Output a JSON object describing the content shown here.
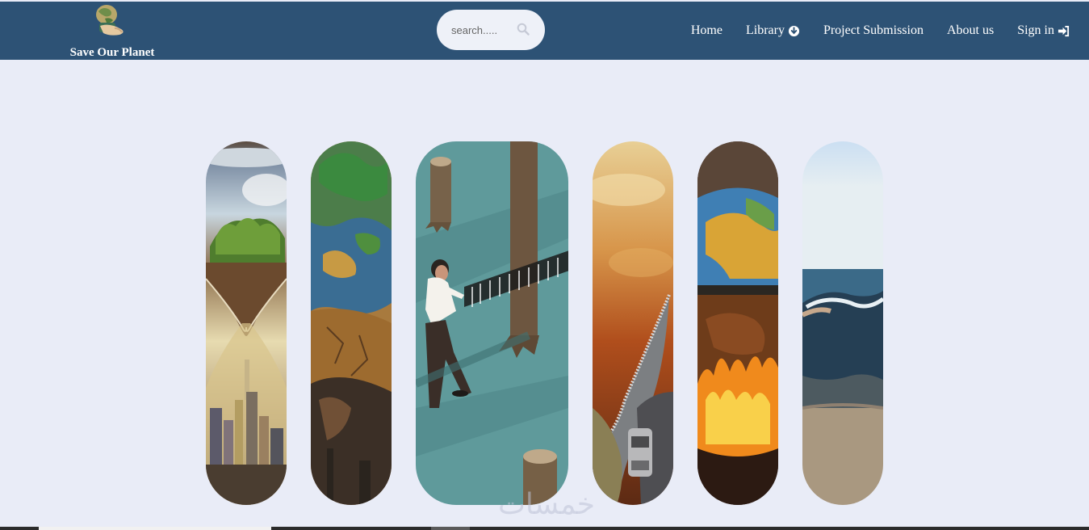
{
  "brand": {
    "name": "Save Our Planet",
    "logo_icon": "globe-in-hand-icon"
  },
  "search": {
    "placeholder": "search.....",
    "icon": "search-icon"
  },
  "nav": {
    "items": [
      {
        "label": "Home",
        "icon": ""
      },
      {
        "label": "Library",
        "icon": "arrow-circle-down-icon"
      },
      {
        "label": "Project Submission",
        "icon": ""
      },
      {
        "label": "About us",
        "icon": ""
      },
      {
        "label": "Sign in",
        "icon": "sign-in-icon"
      }
    ]
  },
  "gallery": {
    "panels": [
      {
        "subject": "hourglass-earth-city"
      },
      {
        "subject": "cracked-earth-continents"
      },
      {
        "subject": "man-barcode-deforestation"
      },
      {
        "subject": "zipper-landscape-road"
      },
      {
        "subject": "burning-globe"
      },
      {
        "subject": "ocean-wave-hand"
      }
    ]
  },
  "watermark": "خمسات",
  "colors": {
    "navbar": "#2d5275",
    "page_background": "#e9ecf7",
    "search_background": "#eef1f8"
  }
}
